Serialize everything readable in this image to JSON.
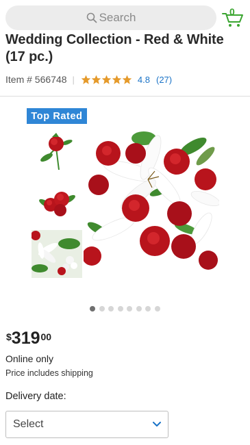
{
  "search": {
    "placeholder": "Search",
    "icon": "search-icon"
  },
  "cart": {
    "count": "0",
    "icon": "cart-icon",
    "color": "#3aa530"
  },
  "product": {
    "title": "Wedding Collection - Red & White (17 pc.)",
    "item_number": "Item # 566748",
    "separator": "|",
    "rating": "4.8",
    "reviews": "(27)",
    "stars_filled": 5,
    "badge": "Top Rated",
    "badge_color": "#2f86d6"
  },
  "gallery": {
    "dot_count": 8,
    "active_dot": 0
  },
  "price": {
    "currency": "$",
    "dollars": "319",
    "cents": "00"
  },
  "availability": {
    "online_only": "Online only",
    "shipping_note": "Price includes shipping"
  },
  "delivery": {
    "label": "Delivery date:",
    "selected": "Select"
  },
  "colors": {
    "link": "#1a73c7",
    "star": "#e59a2b",
    "rose": "#b8141c",
    "leaf": "#3f8a2e"
  }
}
